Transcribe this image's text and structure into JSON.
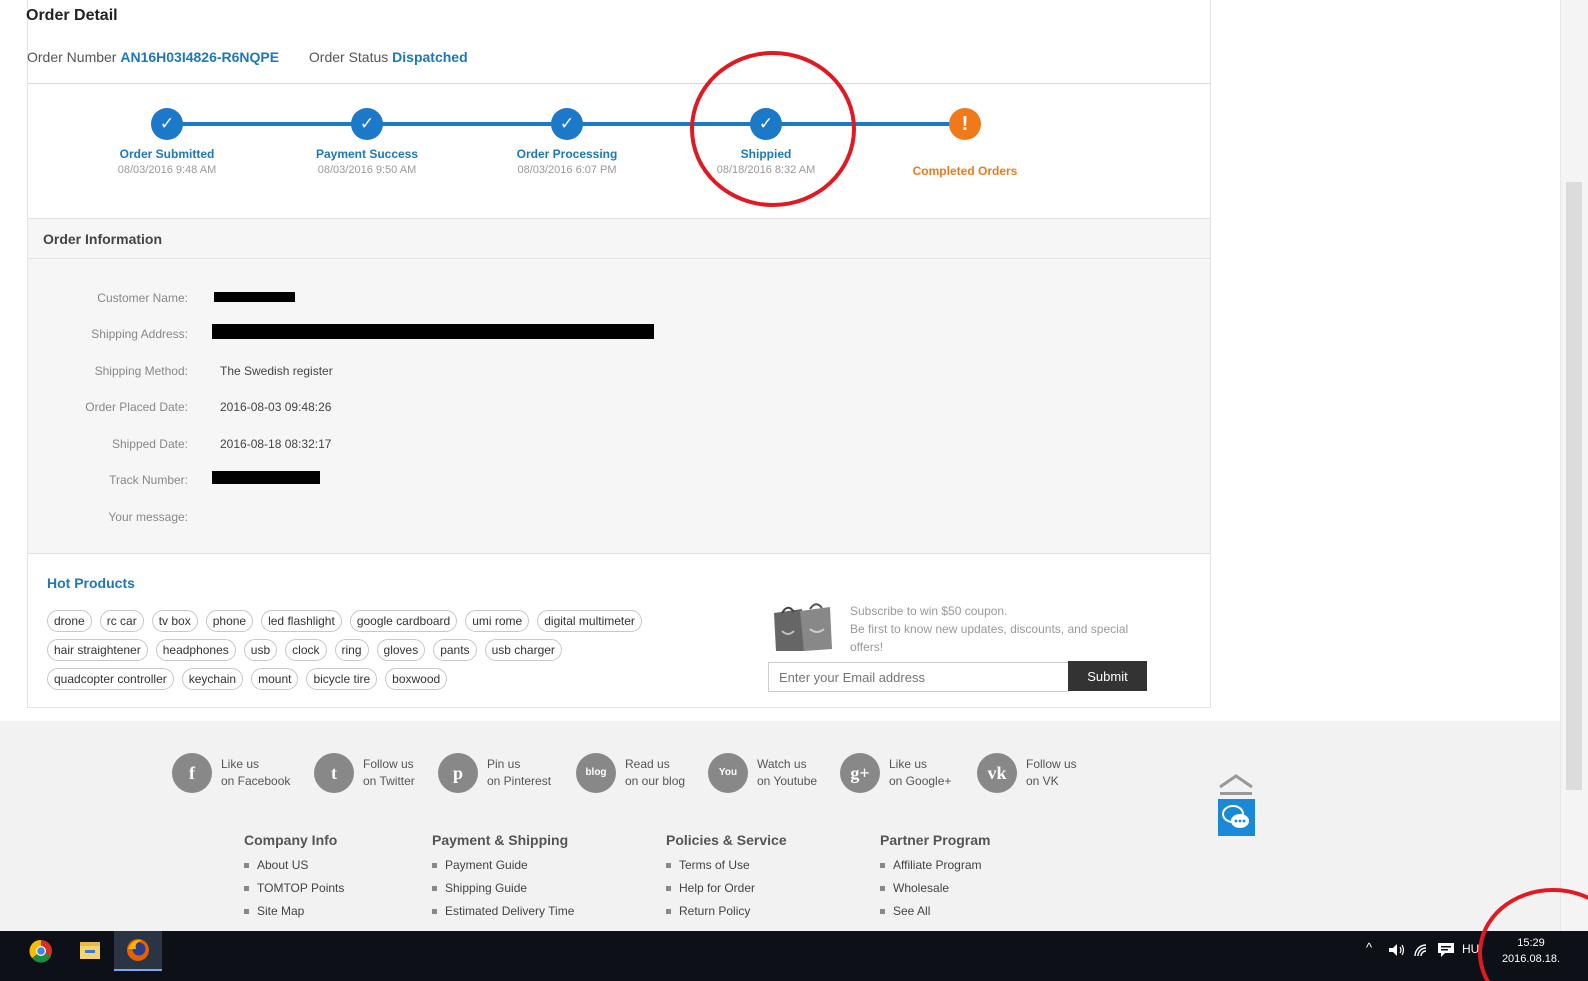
{
  "order": {
    "title": "Order Detail",
    "number_label": "Order Number",
    "number": "AN16H03I4826-R6NQPE",
    "status_label": "Order Status",
    "status": "Dispatched"
  },
  "steps": [
    {
      "label": "Order Submitted",
      "time": "08/03/2016 9:48 AM",
      "state": "done"
    },
    {
      "label": "Payment Success",
      "time": "08/03/2016 9:50 AM",
      "state": "done"
    },
    {
      "label": "Order Processing",
      "time": "08/03/2016 6:07 PM",
      "state": "done"
    },
    {
      "label": "Shippied",
      "time": "08/18/2016 8:32 AM",
      "state": "done"
    },
    {
      "label": "Completed Orders",
      "time": "",
      "state": "pending"
    }
  ],
  "info": {
    "title": "Order Information",
    "rows": [
      {
        "key": "Customer Name:",
        "value": ""
      },
      {
        "key": "Shipping Address:",
        "value": ""
      },
      {
        "key": "Shipping Method:",
        "value": "The Swedish register"
      },
      {
        "key": "Order Placed Date:",
        "value": "2016-08-03 09:48:26"
      },
      {
        "key": "Shipped Date:",
        "value": "2016-08-18 08:32:17"
      },
      {
        "key": "Track Number:",
        "value": ""
      },
      {
        "key": "Your message:",
        "value": ""
      }
    ]
  },
  "hot": {
    "title": "Hot Products",
    "tags": [
      "drone",
      "rc car",
      "tv box",
      "phone",
      "led flashlight",
      "google cardboard",
      "umi rome",
      "digital multimeter",
      "hair straightener",
      "headphones",
      "usb",
      "clock",
      "ring",
      "gloves",
      "pants",
      "usb charger",
      "quadcopter controller",
      "keychain",
      "mount",
      "bicycle tire",
      "boxwood"
    ]
  },
  "subscribe": {
    "line1": "Subscribe to win $50 coupon.",
    "line2": "Be first to know new updates, discounts, and special offers!",
    "placeholder": "Enter your Email address",
    "button": "Submit"
  },
  "social": [
    {
      "icon": "facebook-icon",
      "glyph": "f",
      "line1": "Like us",
      "line2": "on Facebook"
    },
    {
      "icon": "twitter-icon",
      "glyph": "t",
      "line1": "Follow us",
      "line2": "on Twitter"
    },
    {
      "icon": "pinterest-icon",
      "glyph": "p",
      "line1": "Pin us",
      "line2": "on Pinterest"
    },
    {
      "icon": "blog-icon",
      "glyph": "blog",
      "line1": "Read us",
      "line2": "on our blog"
    },
    {
      "icon": "youtube-icon",
      "glyph": "You",
      "line1": "Watch us",
      "line2": "on Youtube"
    },
    {
      "icon": "googleplus-icon",
      "glyph": "g+",
      "line1": "Like us",
      "line2": "on Google+"
    },
    {
      "icon": "vk-icon",
      "glyph": "vk",
      "line1": "Follow us",
      "line2": "on VK"
    }
  ],
  "footer": [
    {
      "title": "Company Info",
      "items": [
        "About US",
        "TOMTOP Points",
        "Site Map"
      ]
    },
    {
      "title": "Payment & Shipping",
      "items": [
        "Payment Guide",
        "Shipping Guide",
        "Estimated Delivery Time"
      ]
    },
    {
      "title": "Policies & Service",
      "items": [
        "Terms of Use",
        "Help for Order",
        "Return Policy"
      ]
    },
    {
      "title": "Partner Program",
      "items": [
        "Affiliate Program",
        "Wholesale",
        "See All"
      ]
    }
  ],
  "taskbar": {
    "lang": "HU",
    "time": "15:29",
    "date": "2016.08.18."
  },
  "colors": {
    "accent_blue": "#1c78c8",
    "warning_orange": "#f07a1a",
    "annotation_red": "#e01a22"
  }
}
